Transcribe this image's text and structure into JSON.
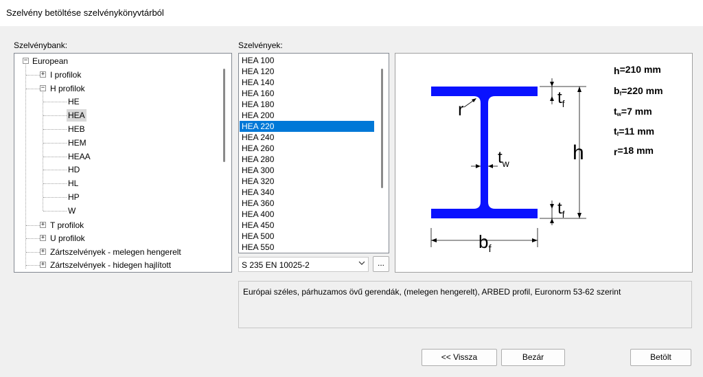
{
  "window": {
    "title": "Szelvény betöltése szelvénykönyvtárból"
  },
  "labels": {
    "bank": "Szelvénybank:",
    "profiles": "Szelvények:"
  },
  "tree": {
    "root": "European",
    "groups": [
      "I profilok",
      "H profilok",
      "T profilok",
      "U profilok",
      "Zártszelvények - melegen hengerelt",
      "Zártszelvények - hidegen hajlított"
    ],
    "h_children": [
      "HE",
      "HEA",
      "HEB",
      "HEM",
      "HEAA",
      "HD",
      "HL",
      "HP",
      "W"
    ],
    "selected": "HEA"
  },
  "profiles": {
    "items": [
      "HEA 100",
      "HEA 120",
      "HEA 140",
      "HEA 160",
      "HEA 180",
      "HEA 200",
      "HEA 220",
      "HEA 240",
      "HEA 260",
      "HEA 280",
      "HEA 300",
      "HEA 320",
      "HEA 340",
      "HEA 360",
      "HEA 400",
      "HEA 450",
      "HEA 500",
      "HEA 550"
    ],
    "selected": "HEA 220"
  },
  "material": {
    "value": "S 235 EN 10025-2",
    "more_label": "..."
  },
  "diagram": {
    "labels": {
      "r": "r",
      "t": "t",
      "f": "f",
      "w": "w",
      "h": "h",
      "b": "b"
    },
    "dims": [
      {
        "sym": "h",
        "sub": "",
        "text": "=210 mm"
      },
      {
        "sym": "b",
        "sub": "f",
        "text": "=220 mm"
      },
      {
        "sym": "t",
        "sub": "w",
        "text": "=7 mm"
      },
      {
        "sym": "t",
        "sub": "f",
        "text": "=11 mm"
      },
      {
        "sym": "r",
        "sub": "",
        "text": "=18 mm"
      }
    ],
    "colors": {
      "section": "#0a12ff",
      "lines": "#000000"
    }
  },
  "description": "Európai széles, párhuzamos övű gerendák, (melegen hengerelt), ARBED profil, Euronorm 53-62 szerint",
  "buttons": {
    "back": "<< Vissza",
    "close": "Bezár",
    "load": "Betölt"
  },
  "colors": {
    "selection": "#0078d7"
  }
}
